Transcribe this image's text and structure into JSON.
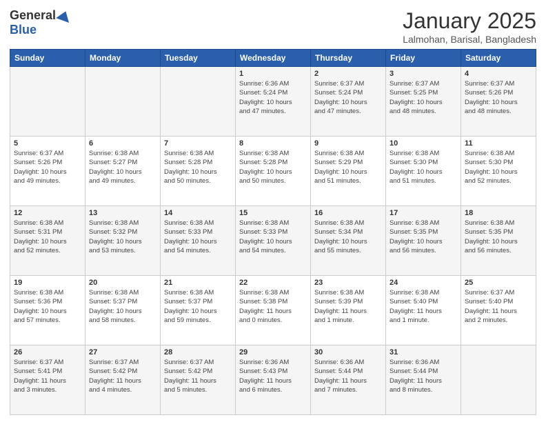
{
  "logo": {
    "general": "General",
    "blue": "Blue"
  },
  "title": "January 2025",
  "location": "Lalmohan, Barisal, Bangladesh",
  "days_of_week": [
    "Sunday",
    "Monday",
    "Tuesday",
    "Wednesday",
    "Thursday",
    "Friday",
    "Saturday"
  ],
  "weeks": [
    [
      {
        "day": "",
        "info": ""
      },
      {
        "day": "",
        "info": ""
      },
      {
        "day": "",
        "info": ""
      },
      {
        "day": "1",
        "info": "Sunrise: 6:36 AM\nSunset: 5:24 PM\nDaylight: 10 hours\nand 47 minutes."
      },
      {
        "day": "2",
        "info": "Sunrise: 6:37 AM\nSunset: 5:24 PM\nDaylight: 10 hours\nand 47 minutes."
      },
      {
        "day": "3",
        "info": "Sunrise: 6:37 AM\nSunset: 5:25 PM\nDaylight: 10 hours\nand 48 minutes."
      },
      {
        "day": "4",
        "info": "Sunrise: 6:37 AM\nSunset: 5:26 PM\nDaylight: 10 hours\nand 48 minutes."
      }
    ],
    [
      {
        "day": "5",
        "info": "Sunrise: 6:37 AM\nSunset: 5:26 PM\nDaylight: 10 hours\nand 49 minutes."
      },
      {
        "day": "6",
        "info": "Sunrise: 6:38 AM\nSunset: 5:27 PM\nDaylight: 10 hours\nand 49 minutes."
      },
      {
        "day": "7",
        "info": "Sunrise: 6:38 AM\nSunset: 5:28 PM\nDaylight: 10 hours\nand 50 minutes."
      },
      {
        "day": "8",
        "info": "Sunrise: 6:38 AM\nSunset: 5:28 PM\nDaylight: 10 hours\nand 50 minutes."
      },
      {
        "day": "9",
        "info": "Sunrise: 6:38 AM\nSunset: 5:29 PM\nDaylight: 10 hours\nand 51 minutes."
      },
      {
        "day": "10",
        "info": "Sunrise: 6:38 AM\nSunset: 5:30 PM\nDaylight: 10 hours\nand 51 minutes."
      },
      {
        "day": "11",
        "info": "Sunrise: 6:38 AM\nSunset: 5:30 PM\nDaylight: 10 hours\nand 52 minutes."
      }
    ],
    [
      {
        "day": "12",
        "info": "Sunrise: 6:38 AM\nSunset: 5:31 PM\nDaylight: 10 hours\nand 52 minutes."
      },
      {
        "day": "13",
        "info": "Sunrise: 6:38 AM\nSunset: 5:32 PM\nDaylight: 10 hours\nand 53 minutes."
      },
      {
        "day": "14",
        "info": "Sunrise: 6:38 AM\nSunset: 5:33 PM\nDaylight: 10 hours\nand 54 minutes."
      },
      {
        "day": "15",
        "info": "Sunrise: 6:38 AM\nSunset: 5:33 PM\nDaylight: 10 hours\nand 54 minutes."
      },
      {
        "day": "16",
        "info": "Sunrise: 6:38 AM\nSunset: 5:34 PM\nDaylight: 10 hours\nand 55 minutes."
      },
      {
        "day": "17",
        "info": "Sunrise: 6:38 AM\nSunset: 5:35 PM\nDaylight: 10 hours\nand 56 minutes."
      },
      {
        "day": "18",
        "info": "Sunrise: 6:38 AM\nSunset: 5:35 PM\nDaylight: 10 hours\nand 56 minutes."
      }
    ],
    [
      {
        "day": "19",
        "info": "Sunrise: 6:38 AM\nSunset: 5:36 PM\nDaylight: 10 hours\nand 57 minutes."
      },
      {
        "day": "20",
        "info": "Sunrise: 6:38 AM\nSunset: 5:37 PM\nDaylight: 10 hours\nand 58 minutes."
      },
      {
        "day": "21",
        "info": "Sunrise: 6:38 AM\nSunset: 5:37 PM\nDaylight: 10 hours\nand 59 minutes."
      },
      {
        "day": "22",
        "info": "Sunrise: 6:38 AM\nSunset: 5:38 PM\nDaylight: 11 hours\nand 0 minutes."
      },
      {
        "day": "23",
        "info": "Sunrise: 6:38 AM\nSunset: 5:39 PM\nDaylight: 11 hours\nand 1 minute."
      },
      {
        "day": "24",
        "info": "Sunrise: 6:38 AM\nSunset: 5:40 PM\nDaylight: 11 hours\nand 1 minute."
      },
      {
        "day": "25",
        "info": "Sunrise: 6:37 AM\nSunset: 5:40 PM\nDaylight: 11 hours\nand 2 minutes."
      }
    ],
    [
      {
        "day": "26",
        "info": "Sunrise: 6:37 AM\nSunset: 5:41 PM\nDaylight: 11 hours\nand 3 minutes."
      },
      {
        "day": "27",
        "info": "Sunrise: 6:37 AM\nSunset: 5:42 PM\nDaylight: 11 hours\nand 4 minutes."
      },
      {
        "day": "28",
        "info": "Sunrise: 6:37 AM\nSunset: 5:42 PM\nDaylight: 11 hours\nand 5 minutes."
      },
      {
        "day": "29",
        "info": "Sunrise: 6:36 AM\nSunset: 5:43 PM\nDaylight: 11 hours\nand 6 minutes."
      },
      {
        "day": "30",
        "info": "Sunrise: 6:36 AM\nSunset: 5:44 PM\nDaylight: 11 hours\nand 7 minutes."
      },
      {
        "day": "31",
        "info": "Sunrise: 6:36 AM\nSunset: 5:44 PM\nDaylight: 11 hours\nand 8 minutes."
      },
      {
        "day": "",
        "info": ""
      }
    ]
  ]
}
